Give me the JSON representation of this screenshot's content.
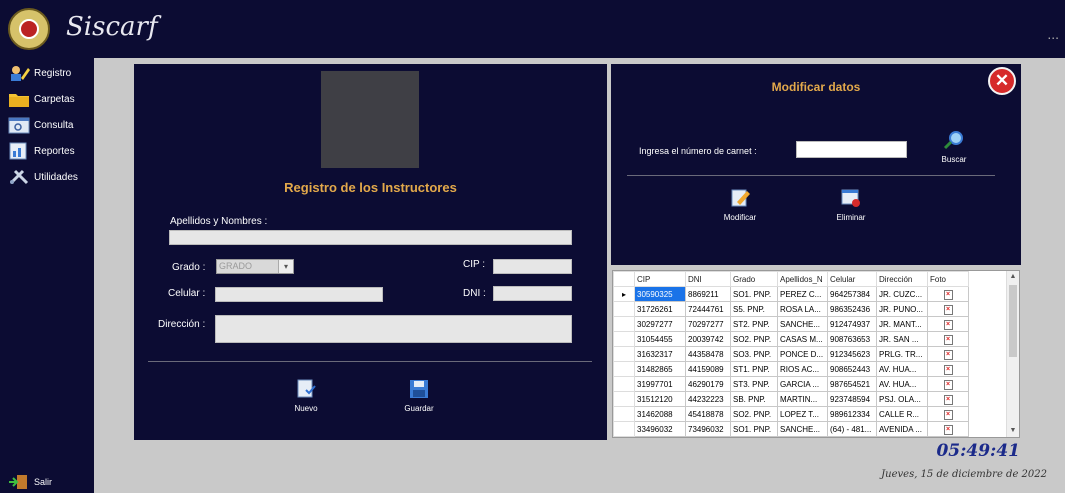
{
  "app": {
    "title": "Siscarf",
    "overflow": "..."
  },
  "sidebar": {
    "items": [
      {
        "label": "Registro",
        "icon": "register-icon"
      },
      {
        "label": "Carpetas",
        "icon": "folder-icon"
      },
      {
        "label": "Consulta",
        "icon": "search-window-icon"
      },
      {
        "label": "Reportes",
        "icon": "report-icon"
      },
      {
        "label": "Utilidades",
        "icon": "tools-icon"
      }
    ],
    "exit_label": "Salir"
  },
  "registro": {
    "title": "Registro de los Instructores",
    "names_label": "Apellidos y Nombres :",
    "grade_label": "Grado :",
    "grade_value": "GRADO",
    "cip_label": "CIP :",
    "celular_label": "Celular :",
    "dni_label": "DNI :",
    "direccion_label": "Dirección :",
    "nuevo_label": "Nuevo",
    "guardar_label": "Guardar"
  },
  "modificar": {
    "title": "Modificar datos",
    "carnet_label": "Ingresa el número de carnet :",
    "buscar_label": "Buscar",
    "modificar_label": "Modificar",
    "eliminar_label": "Eliminar"
  },
  "grid": {
    "columns": [
      "CIP",
      "DNI",
      "Grado",
      "Apellidos_N",
      "Celular",
      "Dirección",
      "Foto"
    ],
    "rows": [
      [
        "30590325",
        "8869211",
        "SO1. PNP.",
        "PEREZ C...",
        "964257384",
        "JR. CUZC..."
      ],
      [
        "31726261",
        "72444761",
        "S5. PNP.",
        "ROSA LA...",
        "986352436",
        "JR. PUNO..."
      ],
      [
        "30297277",
        "70297277",
        "ST2. PNP.",
        "SANCHE...",
        "912474937",
        "JR. MANT..."
      ],
      [
        "31054455",
        "20039742",
        "SO2. PNP.",
        "CASAS M...",
        "908763653",
        "JR. SAN ..."
      ],
      [
        "31632317",
        "44358478",
        "SO3. PNP.",
        "PONCE D...",
        "912345623",
        "PRLG. TR..."
      ],
      [
        "31482865",
        "44159089",
        "ST1. PNP.",
        "RIOS AC...",
        "908652443",
        "AV. HUA..."
      ],
      [
        "31997701",
        "46290179",
        "ST3. PNP.",
        "GARCIA ...",
        "987654521",
        "AV. HUA..."
      ],
      [
        "31512120",
        "44232223",
        "SB. PNP.",
        "MARTIN...",
        "923748594",
        "PSJ. OLA..."
      ],
      [
        "31462088",
        "45418878",
        "SO2. PNP.",
        "LOPEZ T...",
        "989612334",
        "CALLE R..."
      ],
      [
        "33496032",
        "73496032",
        "SO1. PNP.",
        "SANCHE...",
        "(64) - 481...",
        "AVENIDA ..."
      ]
    ]
  },
  "status": {
    "time": "05:49:41",
    "date": "Jueves, 15 de diciembre de 2022"
  },
  "colors": {
    "background": "#c9c9c9",
    "panel": "#0c0c33",
    "accent": "#e3a94b",
    "clock": "#1b2a8a"
  }
}
